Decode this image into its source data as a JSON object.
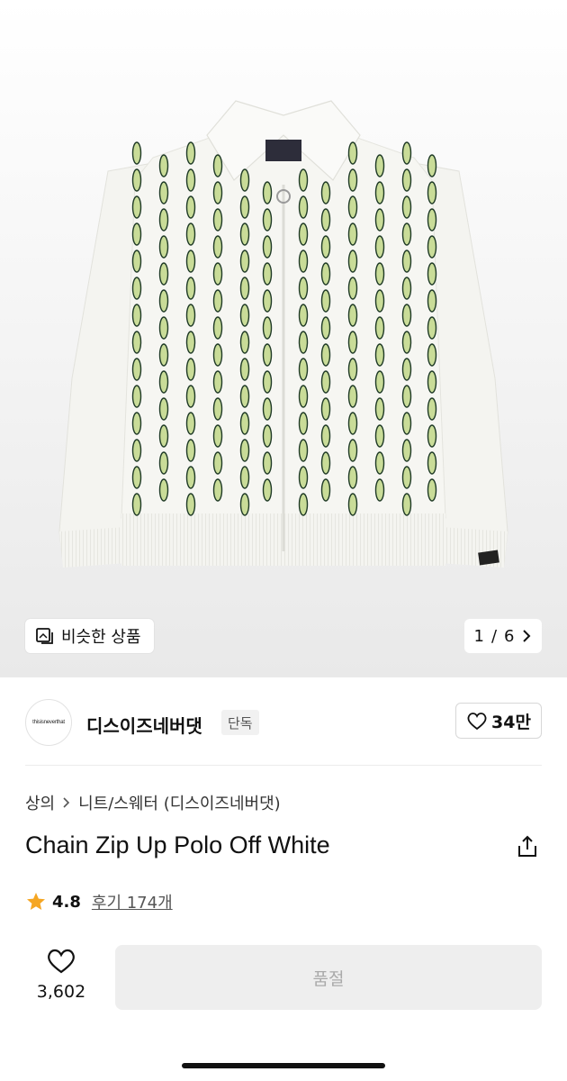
{
  "gallery": {
    "similar_label": "비슷한 상품",
    "pager_current": "1",
    "pager_total": "6",
    "pager_sep": "/",
    "pattern_colors": {
      "knit": "#f6f6f2",
      "chain_dark": "#1f3a26",
      "chain_light": "#c9dc98"
    },
    "tag_text": "thisisneverthat"
  },
  "brand": {
    "logo_text": "thisisneverthat",
    "name": "디스이즈네버댓",
    "badge": "단독",
    "like_count": "34만"
  },
  "product": {
    "breadcrumb": [
      "상의",
      "니트/스웨터 (디스이즈네버댓)"
    ],
    "title": "Chain Zip Up Polo Off White",
    "rating": "4.8",
    "review_label": "후기 174개",
    "star_color": "#f5a623"
  },
  "actions": {
    "wish_count": "3,602",
    "sold_out_label": "품절"
  }
}
